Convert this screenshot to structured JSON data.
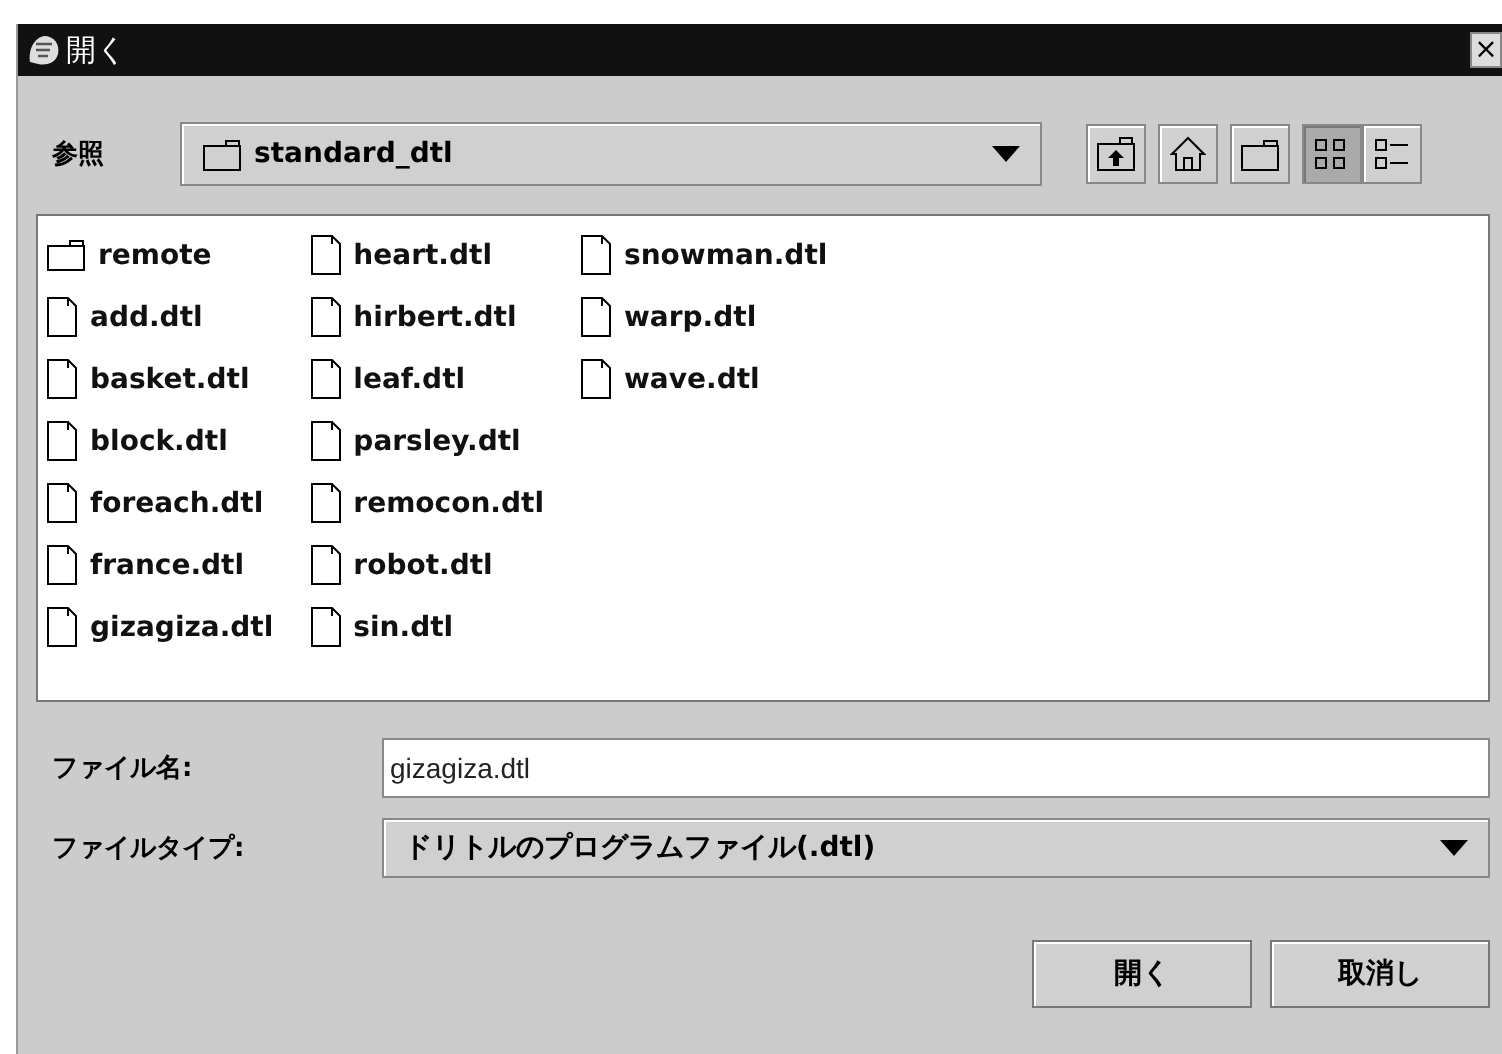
{
  "window": {
    "title": "開く",
    "close": "×"
  },
  "look_in": {
    "label": "参照",
    "value": "standard_dtl"
  },
  "toolbar": [
    {
      "kind": "up",
      "selected": false
    },
    {
      "kind": "home",
      "selected": false
    },
    {
      "kind": "newfolder",
      "selected": false
    },
    {
      "kind": "list",
      "selected": true
    },
    {
      "kind": "details",
      "selected": false
    }
  ],
  "files": [
    {
      "name": "remote",
      "kind": "folder"
    },
    {
      "name": "add.dtl",
      "kind": "file"
    },
    {
      "name": "basket.dtl",
      "kind": "file"
    },
    {
      "name": "block.dtl",
      "kind": "file"
    },
    {
      "name": "foreach.dtl",
      "kind": "file"
    },
    {
      "name": "france.dtl",
      "kind": "file"
    },
    {
      "name": "gizagiza.dtl",
      "kind": "file"
    },
    {
      "name": "heart.dtl",
      "kind": "file"
    },
    {
      "name": "hirbert.dtl",
      "kind": "file"
    },
    {
      "name": "leaf.dtl",
      "kind": "file"
    },
    {
      "name": "parsley.dtl",
      "kind": "file"
    },
    {
      "name": "remocon.dtl",
      "kind": "file"
    },
    {
      "name": "robot.dtl",
      "kind": "file"
    },
    {
      "name": "sin.dtl",
      "kind": "file"
    },
    {
      "name": "snowman.dtl",
      "kind": "file"
    },
    {
      "name": "warp.dtl",
      "kind": "file"
    },
    {
      "name": "wave.dtl",
      "kind": "file"
    }
  ],
  "file_name": {
    "label": "ファイル名:",
    "value": "gizagiza.dtl"
  },
  "file_type": {
    "label": "ファイルタイプ:",
    "value": "ドリトルのプログラムファイル(.dtl)"
  },
  "buttons": [
    "開く",
    "取消し"
  ]
}
